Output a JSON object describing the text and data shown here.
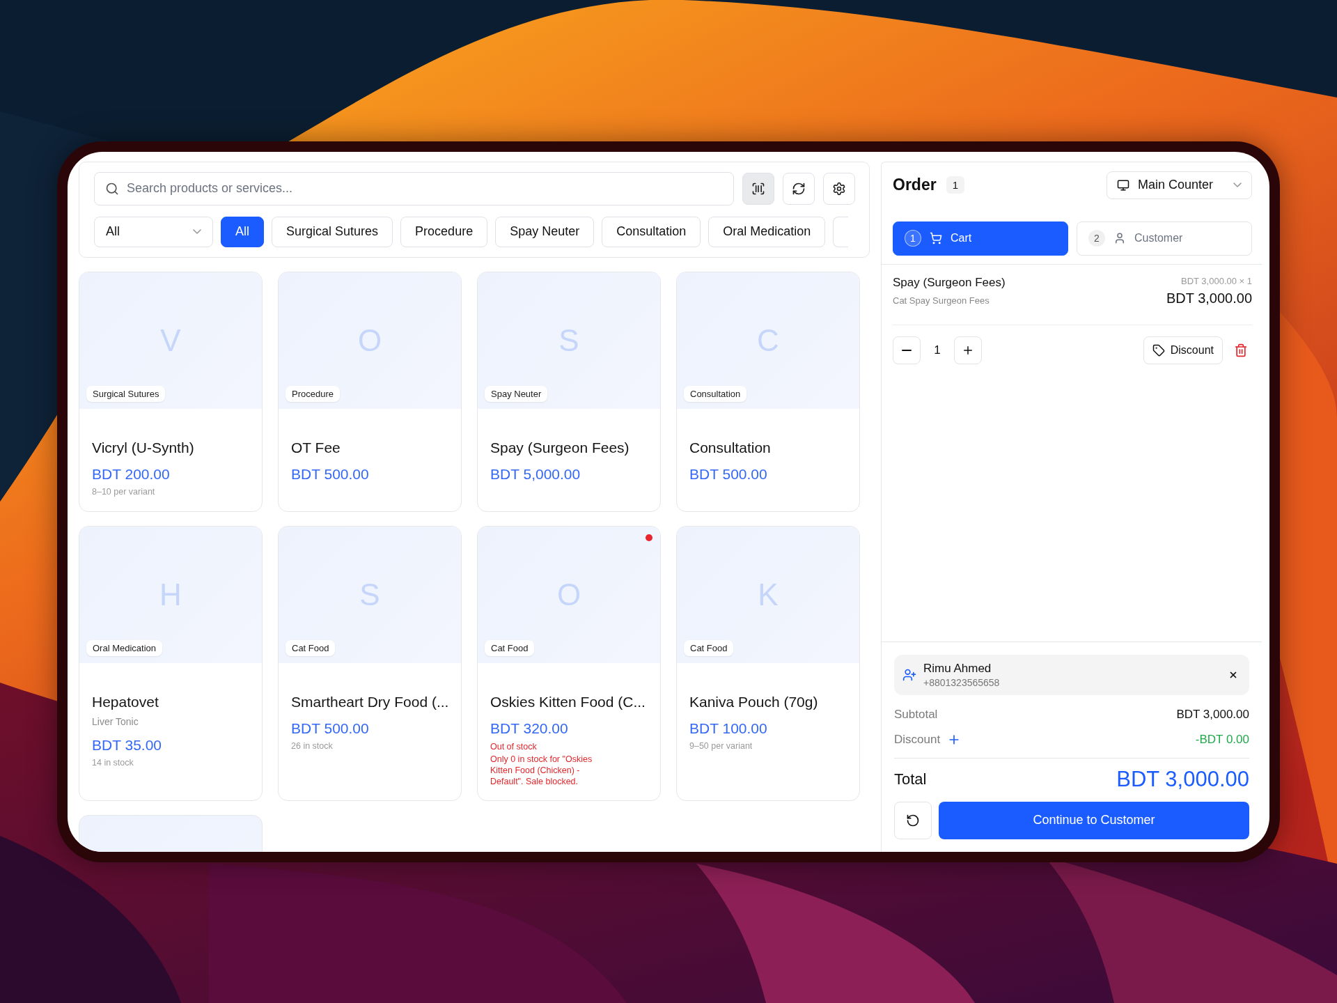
{
  "search": {
    "placeholder": "Search products or services..."
  },
  "scan_button": {
    "active": true
  },
  "category_select": {
    "value": "All"
  },
  "category_chips": [
    {
      "kind": "chip",
      "label": "All",
      "selected": true
    },
    {
      "kind": "chip",
      "label": "Surgical Sutures",
      "selected": false
    },
    {
      "kind": "chip",
      "label": "Procedure",
      "selected": false
    },
    {
      "kind": "chip",
      "label": "Spay Neuter",
      "selected": false
    },
    {
      "kind": "chip",
      "label": "Consultation",
      "selected": false
    },
    {
      "kind": "chip",
      "label": "Oral Medication",
      "selected": false
    },
    {
      "kind": "cut",
      "selected": false
    }
  ],
  "products": [
    {
      "kind": "card",
      "initial": "V",
      "category": "Surgical Sutures",
      "name": "Vicryl (U-Synth)",
      "price": "BDT 200.00",
      "note": "8–10 per variant",
      "alert": false
    },
    {
      "kind": "card",
      "initial": "O",
      "category": "Procedure",
      "name": "OT Fee",
      "price": "BDT 500.00",
      "alert": false
    },
    {
      "kind": "card",
      "initial": "S",
      "category": "Spay Neuter",
      "name": "Spay (Surgeon Fees)",
      "price": "BDT 5,000.00",
      "alert": false
    },
    {
      "kind": "card",
      "initial": "C",
      "category": "Consultation",
      "name": "Consultation",
      "price": "BDT 500.00",
      "alert": false
    },
    {
      "kind": "card",
      "initial": "H",
      "category": "Oral Medication",
      "name": "Hepatovet",
      "subtitle": "Liver Tonic",
      "price": "BDT 35.00",
      "note": "14 in stock",
      "alert": false
    },
    {
      "kind": "card",
      "initial": "S",
      "category": "Cat Food",
      "name": "Smartheart Dry Food (...",
      "price": "BDT 500.00",
      "note": "26 in stock",
      "alert": false
    },
    {
      "kind": "card",
      "initial": "O",
      "category": "Cat Food",
      "name": "Oskies Kitten Food (C...",
      "price": "BDT 320.00",
      "warnings": [
        "Out of stock",
        "Only 0 in stock for \"Oskies Kitten Food (Chicken) - Default\". Sale blocked."
      ],
      "alert": true
    },
    {
      "kind": "card",
      "initial": "K",
      "category": "Cat Food",
      "name": "Kaniva Pouch (70g)",
      "price": "BDT 100.00",
      "note": "9–50 per variant",
      "alert": false
    },
    {
      "kind": "cut"
    }
  ],
  "order": {
    "title": "Order",
    "count": "1",
    "counter": "Main Counter",
    "steps": [
      {
        "kind": "cart",
        "number": "1",
        "label": "Cart",
        "selected": true
      },
      {
        "kind": "customer",
        "number": "2",
        "label": "Customer",
        "selected": false
      }
    ],
    "items": [
      {
        "name": "Spay (Surgeon Fees)",
        "description": "Cat Spay Surgeon Fees",
        "unit_price": "BDT 3,000.00 × 1",
        "total": "BDT 3,000.00",
        "quantity": "1",
        "discount_label": "Discount"
      }
    ],
    "customer": {
      "name": "Rimu Ahmed",
      "phone": "+8801323565658"
    },
    "summary": {
      "subtotal_label": "Subtotal",
      "subtotal": "BDT 3,000.00",
      "discount_label": "Discount",
      "discount": "-BDT 0.00",
      "total_label": "Total",
      "total": "BDT 3,000.00"
    },
    "continue_button": "Continue to Customer"
  }
}
